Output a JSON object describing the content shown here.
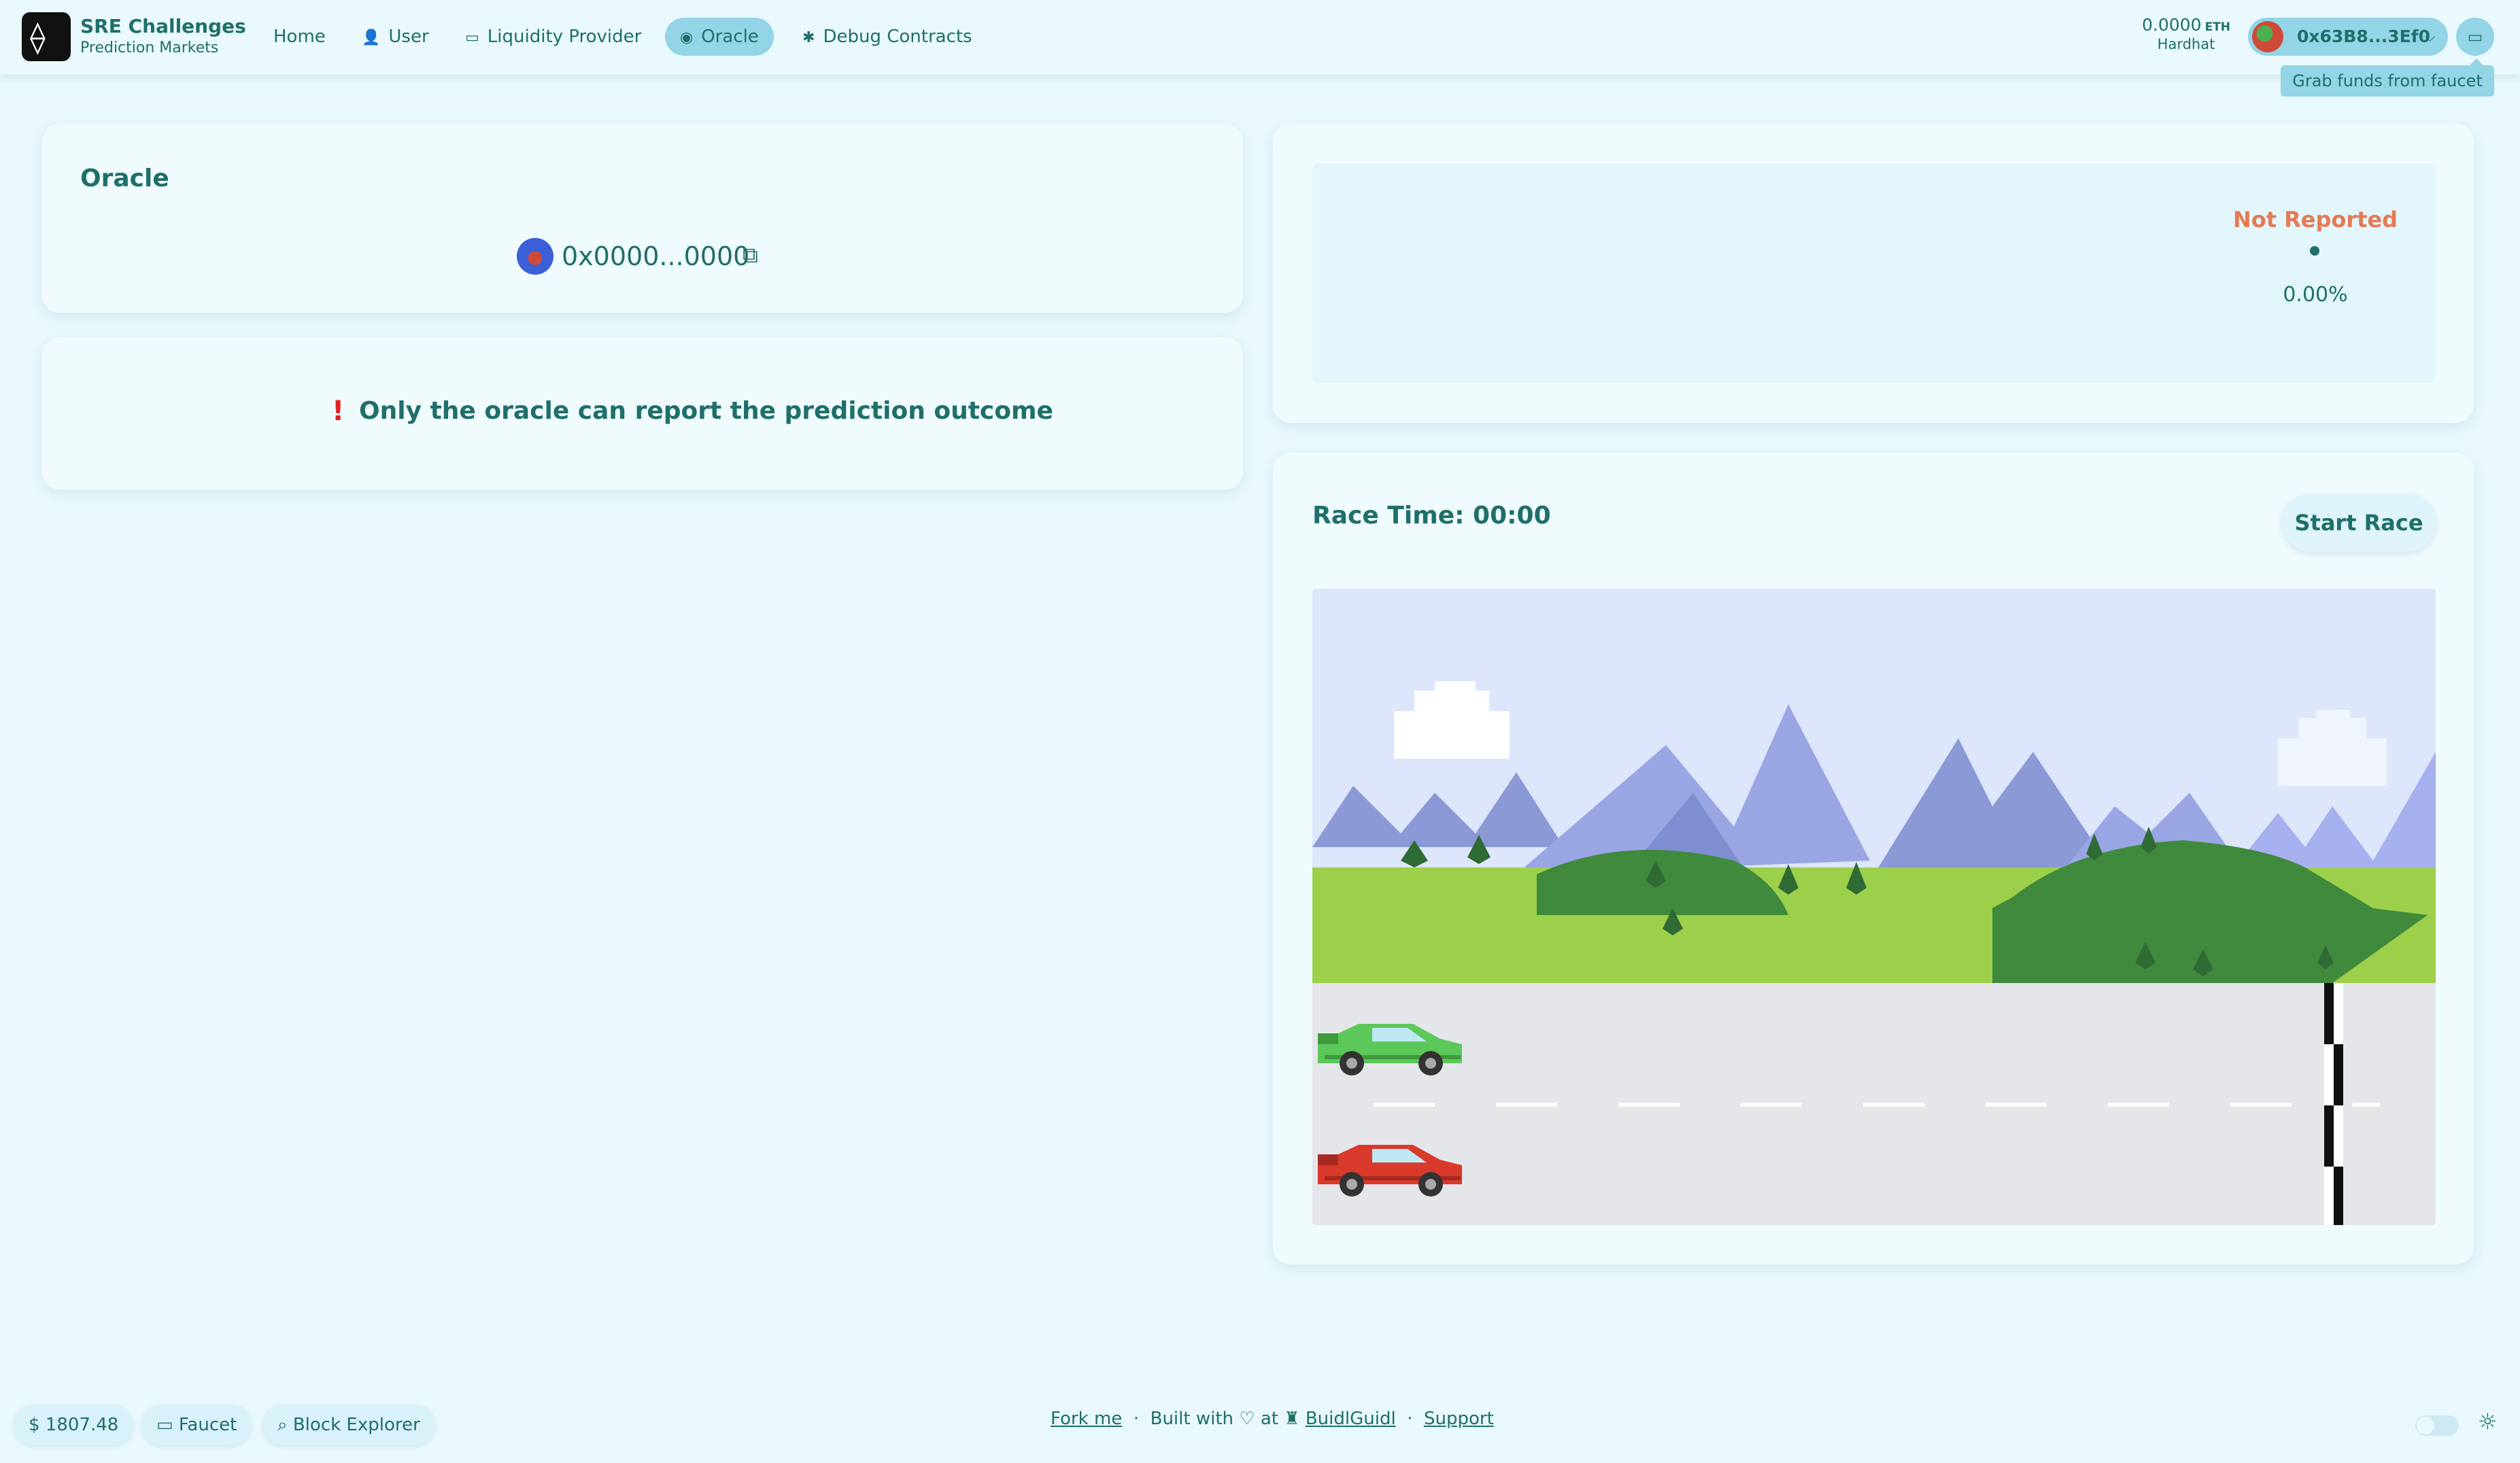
{
  "header": {
    "brand_title": "SRE Challenges",
    "brand_subtitle": "Prediction Markets",
    "nav": [
      {
        "label": "Home",
        "icon": ""
      },
      {
        "label": "User",
        "icon": "user-icon"
      },
      {
        "label": "Liquidity Provider",
        "icon": "banknote-icon"
      },
      {
        "label": "Oracle",
        "icon": "eye-icon",
        "active": true
      },
      {
        "label": "Debug Contracts",
        "icon": "bug-icon"
      }
    ],
    "balance_value": "0.0000",
    "balance_unit": "ETH",
    "network": "Hardhat",
    "account_address": "0x63B8...3Ef0",
    "faucet_tooltip": "Grab funds from faucet"
  },
  "oracle_card": {
    "title": "Oracle",
    "address": "0x0000...0000"
  },
  "notice": {
    "icon": "!",
    "text": "Only the oracle can report the prediction outcome"
  },
  "status_card": {
    "status": "Not Reported",
    "percentage": "0.00%"
  },
  "race": {
    "time_label": "Race Time: 00:00",
    "start_label": "Start Race",
    "cars": [
      {
        "name": "green car",
        "color": "#5cc85a",
        "progress": 0
      },
      {
        "name": "red car",
        "color": "#d93a2b",
        "progress": 0
      }
    ]
  },
  "footer": {
    "price": "1807.48",
    "faucet": "Faucet",
    "explorer": "Block Explorer",
    "fork": "Fork me",
    "sep1": "·",
    "built_with": "Built with",
    "at": "at",
    "buidlguidl": "BuidlGuidl",
    "sep2": "·",
    "support": "Support"
  },
  "colors": {
    "primary": "#1f6f6a",
    "accent": "#93d4e6",
    "background": "#e8f8fd",
    "status_not_reported": "#e57a55"
  }
}
